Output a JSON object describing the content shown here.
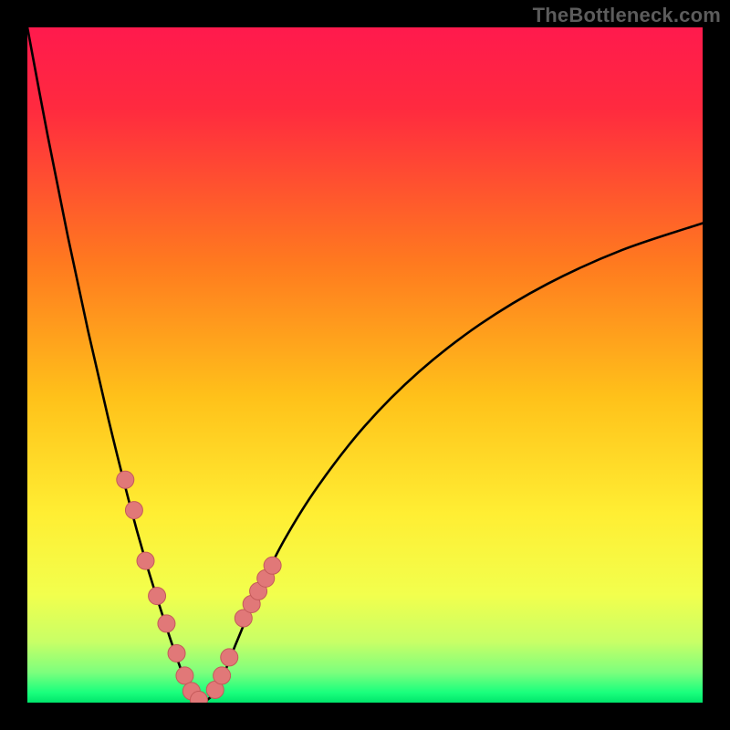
{
  "watermark": "TheBottleneck.com",
  "colors": {
    "frame": "#000000",
    "gradient_stops": [
      {
        "offset": 0.0,
        "color": "#ff1a4d"
      },
      {
        "offset": 0.12,
        "color": "#ff2a3f"
      },
      {
        "offset": 0.35,
        "color": "#ff7a1f"
      },
      {
        "offset": 0.55,
        "color": "#ffc21a"
      },
      {
        "offset": 0.72,
        "color": "#ffee33"
      },
      {
        "offset": 0.84,
        "color": "#f2ff4d"
      },
      {
        "offset": 0.91,
        "color": "#c8ff66"
      },
      {
        "offset": 0.955,
        "color": "#7dff7d"
      },
      {
        "offset": 0.985,
        "color": "#1aff7d"
      },
      {
        "offset": 1.0,
        "color": "#00e56b"
      }
    ],
    "curve": "#000000",
    "marker_fill": "#e17878",
    "marker_stroke": "#c45a5a"
  },
  "chart_data": {
    "type": "line",
    "title": "",
    "xlabel": "",
    "ylabel": "",
    "xlim": [
      0,
      100
    ],
    "ylim": [
      0,
      100
    ],
    "notch_x": 26,
    "series": [
      {
        "name": "left-branch",
        "x": [
          0,
          3,
          6,
          9,
          12,
          15,
          17.5,
          20,
          22,
          23.5,
          24.8,
          26
        ],
        "values": [
          100,
          84,
          69,
          55,
          42,
          30,
          21,
          13,
          7,
          3,
          0.8,
          0
        ]
      },
      {
        "name": "right-branch",
        "x": [
          26,
          27.5,
          29,
          31,
          34,
          38,
          43,
          50,
          58,
          67,
          77,
          88,
          100
        ],
        "values": [
          0,
          1.2,
          4,
          9,
          16,
          24,
          32,
          41,
          49,
          56,
          62,
          67,
          71
        ]
      }
    ],
    "markers": {
      "name": "highlighted-points",
      "x": [
        14.5,
        15.8,
        17.5,
        19.2,
        20.6,
        22.1,
        23.3,
        24.3,
        25.4,
        27.8,
        28.8,
        29.9,
        32.0,
        33.2,
        34.2,
        35.3,
        36.3
      ],
      "values": [
        33.0,
        28.5,
        21.0,
        15.8,
        11.7,
        7.3,
        4.0,
        1.7,
        0.4,
        1.9,
        4.0,
        6.7,
        12.5,
        14.6,
        16.5,
        18.4,
        20.3
      ]
    }
  }
}
